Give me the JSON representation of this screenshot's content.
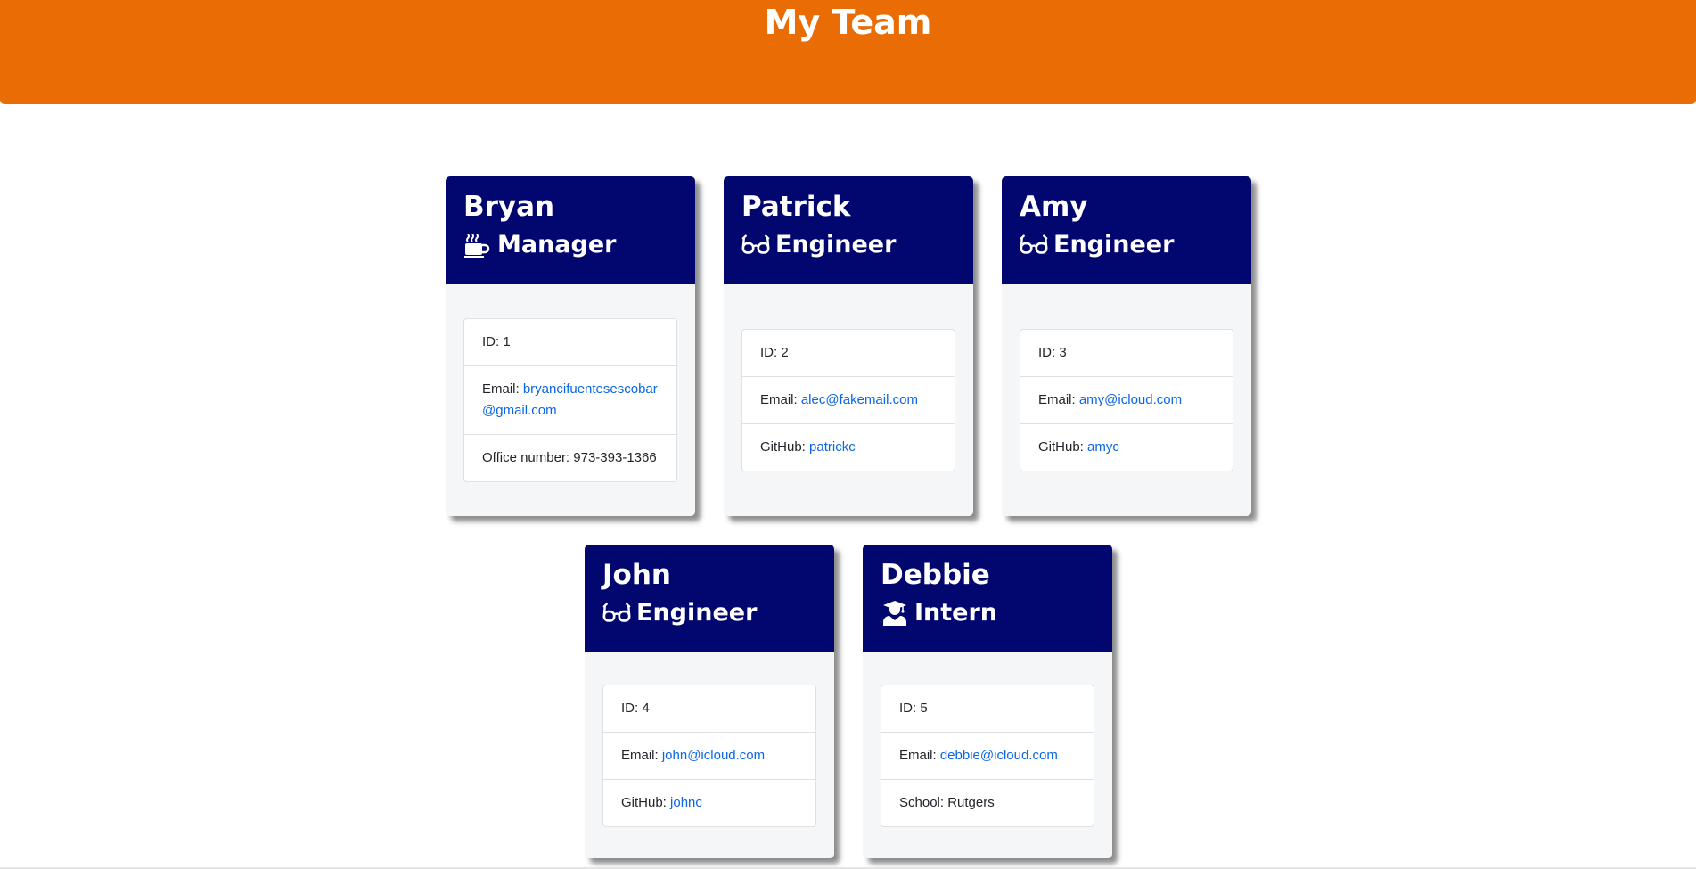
{
  "header": {
    "title": "My Team"
  },
  "members": [
    {
      "name": "Bryan",
      "role": "Manager",
      "icon": "coffee-icon",
      "id_text": "ID: 1",
      "email_label": "Email: ",
      "email": "bryancifuentesescobar@gmail.com",
      "extra_label": "Office number: ",
      "extra_value": "973-393-1366"
    },
    {
      "name": "Patrick",
      "role": "Engineer",
      "icon": "glasses-icon",
      "id_text": "ID: 2",
      "email_label": "Email: ",
      "email": "alec@fakemail.com",
      "extra_label": "GitHub: ",
      "extra_value": "patrickc"
    },
    {
      "name": "Amy",
      "role": "Engineer",
      "icon": "glasses-icon",
      "id_text": "ID: 3",
      "email_label": "Email: ",
      "email": "amy@icloud.com",
      "extra_label": "GitHub: ",
      "extra_value": "amyc"
    },
    {
      "name": "John",
      "role": "Engineer",
      "icon": "glasses-icon",
      "id_text": "ID: 4",
      "email_label": "Email: ",
      "email": "john@icloud.com",
      "extra_label": "GitHub: ",
      "extra_value": "johnc"
    },
    {
      "name": "Debbie",
      "role": "Intern",
      "icon": "graduate-icon",
      "id_text": "ID: 5",
      "email_label": "Email: ",
      "email": "debbie@icloud.com",
      "extra_label": "School: ",
      "extra_value": "Rutgers"
    }
  ],
  "colors": {
    "header_bg": "#e96c04",
    "card_header_bg": "#02066f",
    "link": "#0b66e4"
  }
}
